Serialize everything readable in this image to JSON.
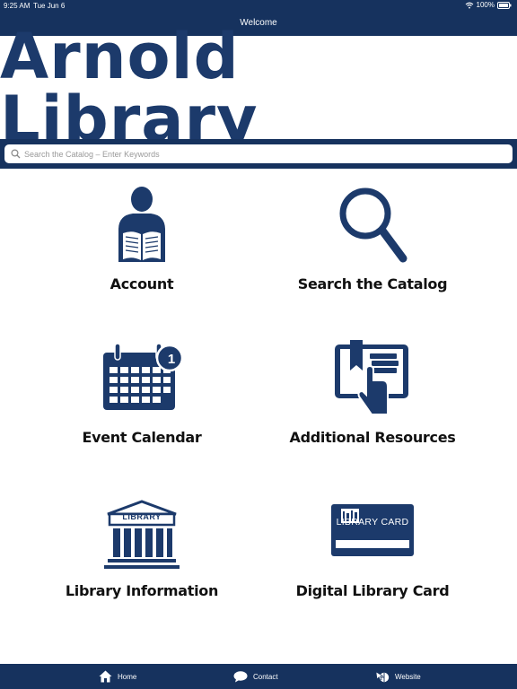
{
  "status": {
    "time": "9:25 AM",
    "date": "Tue Jun 6",
    "battery": "100%"
  },
  "nav": {
    "title": "Welcome"
  },
  "logo": {
    "text": "Arnold Library"
  },
  "search": {
    "placeholder": "Search the Catalog – Enter Keywords"
  },
  "tiles": [
    {
      "label": "Account",
      "icon": "reader-person-icon"
    },
    {
      "label": "Search the Catalog",
      "icon": "magnifier-icon"
    },
    {
      "label": "Event Calendar",
      "icon": "calendar-icon",
      "badge": "1"
    },
    {
      "label": "Additional Resources",
      "icon": "tablet-book-icon"
    },
    {
      "label": "Library Information",
      "icon": "library-building-icon",
      "sign": "LIBRARY"
    },
    {
      "label": "Digital Library Card",
      "icon": "library-card-icon",
      "card_text": "LIBRARY CARD"
    }
  ],
  "tabbar": {
    "home": "Home",
    "contact": "Contact",
    "website": "Website"
  },
  "colors": {
    "navy": "#1c3a6b",
    "white": "#ffffff"
  }
}
